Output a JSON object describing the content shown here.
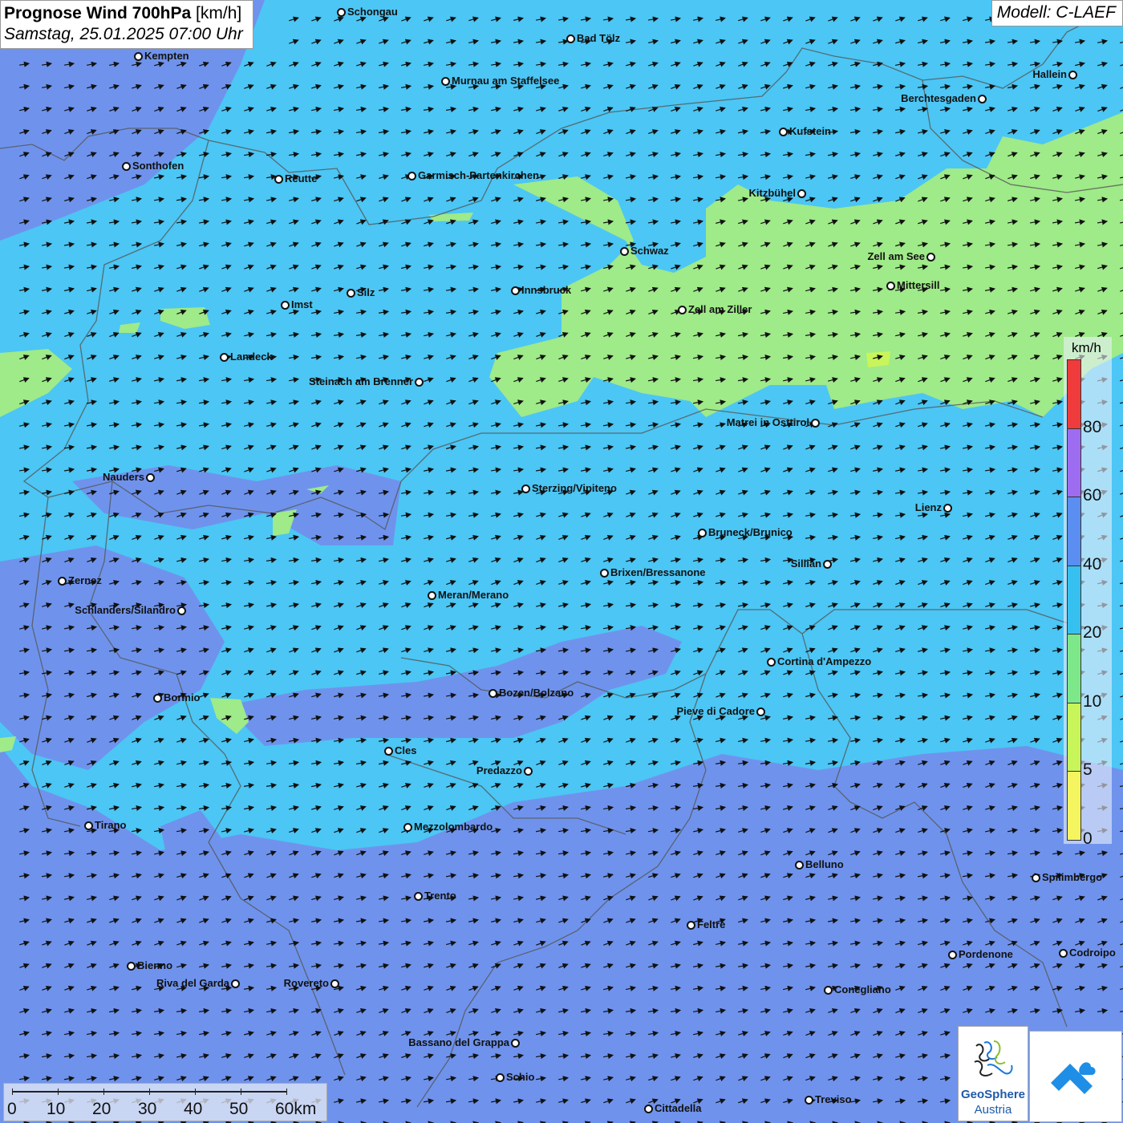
{
  "title": {
    "main": "Prognose Wind 700hPa",
    "unit": "[km/h]",
    "datetime": "Samstag, 25.01.2025 07:00 Uhr"
  },
  "model": "Modell: C-LAEF",
  "cities": [
    {
      "name": "Schongau"
    },
    {
      "name": "Bad Tölz"
    },
    {
      "name": "Kempten"
    },
    {
      "name": "Murnau am Staffelsee"
    },
    {
      "name": "Hallein"
    },
    {
      "name": "Berchtesgaden"
    },
    {
      "name": "Kufstein"
    },
    {
      "name": "Sonthofen"
    },
    {
      "name": "Reutte"
    },
    {
      "name": "Garmisch-Partenkirchen"
    },
    {
      "name": "Kitzbühel"
    },
    {
      "name": "Schwaz"
    },
    {
      "name": "Zell am See"
    },
    {
      "name": "Mittersill"
    },
    {
      "name": "Innsbruck"
    },
    {
      "name": "Silz"
    },
    {
      "name": "Imst"
    },
    {
      "name": "Zell am Ziller"
    },
    {
      "name": "Landeck"
    },
    {
      "name": "Steinach am Brenner"
    },
    {
      "name": "Matrei in Osttirol"
    },
    {
      "name": "Nauders"
    },
    {
      "name": "Sterzing/Vipiteno"
    },
    {
      "name": "Lienz"
    },
    {
      "name": "Bruneck/Brunico"
    },
    {
      "name": "Sillian"
    },
    {
      "name": "Brixen/Bressanone"
    },
    {
      "name": "Zernez"
    },
    {
      "name": "Meran/Merano"
    },
    {
      "name": "Schlanders/Silandro"
    },
    {
      "name": "Cortina d'Ampezzo"
    },
    {
      "name": "Bozen/Bolzano"
    },
    {
      "name": "Bormio"
    },
    {
      "name": "Pieve di Cadore"
    },
    {
      "name": "Cles"
    },
    {
      "name": "Predazzo"
    },
    {
      "name": "Tirano"
    },
    {
      "name": "Mezzolombardo"
    },
    {
      "name": "Belluno"
    },
    {
      "name": "Spilimbergo"
    },
    {
      "name": "Trento"
    },
    {
      "name": "Feltre"
    },
    {
      "name": "Pordenone"
    },
    {
      "name": "Codroipo"
    },
    {
      "name": "Bienno"
    },
    {
      "name": "Riva del Garda"
    },
    {
      "name": "Rovereto"
    },
    {
      "name": "Conegliano"
    },
    {
      "name": "Bassano del Grappa"
    },
    {
      "name": "Schio"
    },
    {
      "name": "Treviso"
    },
    {
      "name": "Cittadella"
    }
  ],
  "legend": {
    "unit": "km/h",
    "labels": [
      "80",
      "60",
      "40",
      "20",
      "10",
      "5",
      "0"
    ],
    "colors": [
      "#ef3b3b",
      "#9d6cf0",
      "#5a8ef0",
      "#36c0f0",
      "#7de88a",
      "#c8f55a",
      "#f5f560"
    ]
  },
  "scale": {
    "labels": [
      "0",
      "10",
      "20",
      "30",
      "40",
      "50",
      "60km"
    ]
  },
  "logos": {
    "geosphere_line1": "GeoSphere",
    "geosphere_line2": "Austria"
  },
  "colors": {
    "background": "#6f93ec",
    "wind_20_40": "#4cc6f4",
    "wind_10_20": "#9fea89",
    "wind_40_60": "#7a8cea",
    "arrow": "#111111"
  }
}
